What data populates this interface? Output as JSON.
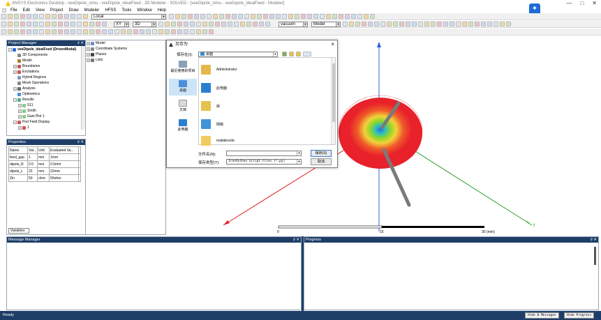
{
  "window": {
    "title": "ANSYS Electronics Desktop - veeDipole_simu - veeDipole_idealFeed - 3D Modeler - SOLVED - [veeDipole_simu - veeDipole_idealFeed - Modeler]",
    "controls": [
      "—",
      "□",
      "✕"
    ]
  },
  "menu": [
    "File",
    "Edit",
    "View",
    "Project",
    "Draw",
    "Modeler",
    "HFSS",
    "Tools",
    "Window",
    "Help"
  ],
  "toolbar": {
    "cs_combo": "Local",
    "plane_combo": "XY",
    "dim_combo": "3D",
    "material_combo": "vacuum",
    "model_combo": "Model"
  },
  "project_manager": {
    "title": "Project Manager",
    "items": [
      {
        "label": "veeDipole_idealFeed (DrivenModal)",
        "level": 1,
        "expand": "−"
      },
      {
        "label": "3D Components",
        "level": 2,
        "expand": ""
      },
      {
        "label": "Model",
        "level": 2,
        "expand": ""
      },
      {
        "label": "Boundaries",
        "level": 2,
        "expand": "+"
      },
      {
        "label": "Excitations",
        "level": 2,
        "expand": "+"
      },
      {
        "label": "Hybrid Regions",
        "level": 2,
        "expand": ""
      },
      {
        "label": "Mesh Operations",
        "level": 2,
        "expand": ""
      },
      {
        "label": "Analysis",
        "level": 2,
        "expand": "+"
      },
      {
        "label": "Optimetrics",
        "level": 2,
        "expand": ""
      },
      {
        "label": "Results",
        "level": 2,
        "expand": "−"
      },
      {
        "label": "S11",
        "level": 3,
        "expand": "+"
      },
      {
        "label": "Smith",
        "level": 3,
        "expand": "+"
      },
      {
        "label": "Gain Plot 1",
        "level": 3,
        "expand": "+"
      },
      {
        "label": "Port Field Display",
        "level": 2,
        "expand": "−"
      },
      {
        "label": "1",
        "level": 3,
        "expand": "+"
      }
    ]
  },
  "model_tree": {
    "items": [
      "Model",
      "Coordinate Systems",
      "Planes",
      "Lists"
    ]
  },
  "properties": {
    "title": "Properties",
    "headers": [
      "Name",
      "Val...",
      "Unit",
      "Evaluated Va..."
    ],
    "rows": [
      [
        "feed_gap",
        "1",
        "mm",
        "1mm"
      ],
      [
        "dipole_R",
        "0.5",
        "mm",
        "0.5mm"
      ],
      [
        "dipole_L",
        "22",
        "mm",
        "22mm"
      ],
      [
        "Zin",
        "50",
        "ohm",
        "50ohm"
      ]
    ],
    "tab": "Variables"
  },
  "dialog": {
    "title": "另存为",
    "save_in_label": "保存在(I):",
    "save_in_value": "桌面",
    "nav": [
      "最近使用的项目",
      "桌面",
      "文档",
      "此电脑"
    ],
    "files": [
      "Administrator",
      "此电脑",
      "库",
      "网络",
      "matlabcode"
    ],
    "filename_label": "文件名(N):",
    "filename_value": "",
    "filetype_label": "保存类型(T):",
    "filetype_value": "IronPython Script Files (*.py)",
    "save_button": "保存(S)",
    "cancel_button": "取消"
  },
  "viewport": {
    "axis_z": "Z",
    "axis_y": "Y",
    "scale_labels": [
      "0",
      "15",
      "30 (mm)"
    ]
  },
  "message_manager": {
    "title": "Message Manager"
  },
  "progress": {
    "title": "Progress"
  },
  "statusbar": {
    "text": "Ready",
    "hide_messages": "Hide 0 Messages",
    "hide_progress": "Hide Progress"
  },
  "colors": {
    "panel_header": "#1e3e68",
    "radiation_red": "#e8212b",
    "radiation_green": "#8bd62a",
    "axis_z": "#2b63d9",
    "axis_y": "#2aa12a",
    "axis_x": "#e02020"
  }
}
